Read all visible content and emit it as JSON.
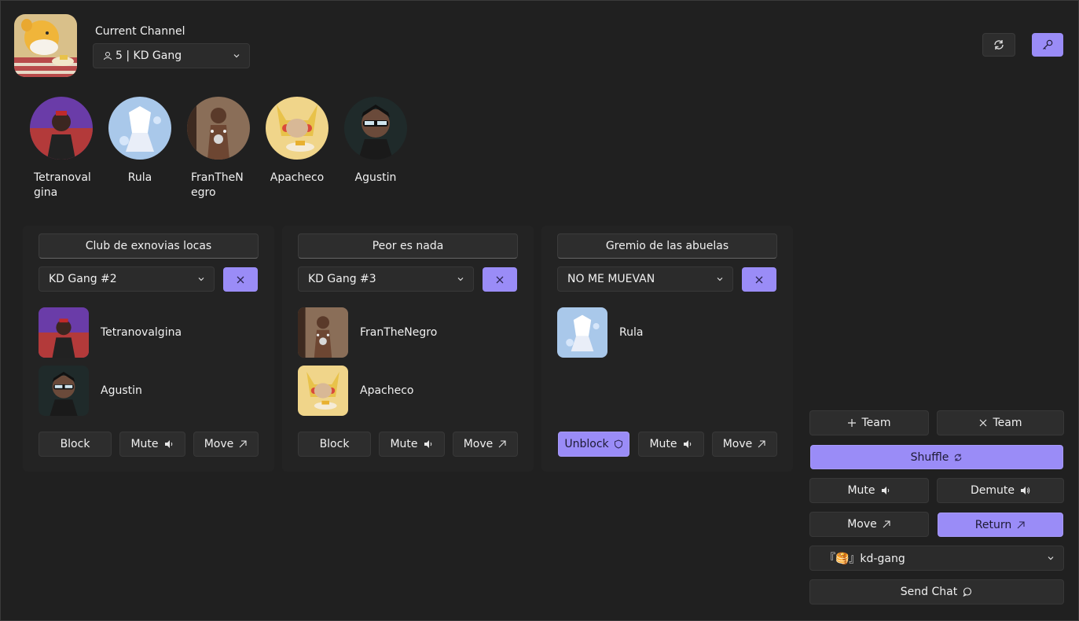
{
  "header": {
    "current_channel_label": "Current Channel",
    "channel_select_value": "5 | KD Gang",
    "icons": {
      "server": "server-avatar-icon",
      "refresh": "refresh-icon",
      "key": "key-icon"
    }
  },
  "members": [
    {
      "name": "Tetranovalgina",
      "color": "#5a3a8a"
    },
    {
      "name": "Rula",
      "color": "#a9c8ea"
    },
    {
      "name": "FranTheNegro",
      "color": "#6b4a36"
    },
    {
      "name": "Apacheco",
      "color": "#e8c24a"
    },
    {
      "name": "Agustin",
      "color": "#2a2a2a"
    }
  ],
  "teams": [
    {
      "name": "Club de exnovias locas",
      "channel": "KD Gang #2",
      "members": [
        "Tetranovalgina",
        "Agustin"
      ],
      "block_label": "Block",
      "mute_label": "Mute",
      "move_label": "Move",
      "blocked": false
    },
    {
      "name": "Peor es nada",
      "channel": "KD Gang #3",
      "members": [
        "FranTheNegro",
        "Apacheco"
      ],
      "block_label": "Block",
      "mute_label": "Mute",
      "move_label": "Move",
      "blocked": false
    },
    {
      "name": "Gremio de las abuelas",
      "channel": "NO ME MUEVAN",
      "members": [
        "Rula"
      ],
      "block_label": "Unblock",
      "mute_label": "Mute",
      "move_label": "Move",
      "blocked": true
    }
  ],
  "controls": {
    "add_team": "Team",
    "remove_team": "Team",
    "shuffle": "Shuffle",
    "mute": "Mute",
    "demute": "Demute",
    "move": "Move",
    "return": "Return",
    "text_channel": "『🥞』kd-gang",
    "send_chat": "Send Chat"
  },
  "colors": {
    "accent": "#9a8cf7",
    "background": "#202020",
    "button": "#2d2d2d"
  }
}
